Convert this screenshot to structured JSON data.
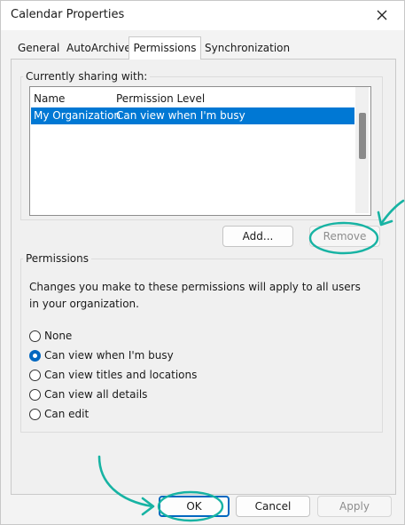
{
  "window": {
    "title": "Calendar Properties"
  },
  "tabs": [
    {
      "label": "General"
    },
    {
      "label": "AutoArchive"
    },
    {
      "label": "Permissions"
    },
    {
      "label": "Synchronization"
    }
  ],
  "sharing": {
    "legend": "Currently sharing with:",
    "columns": {
      "name": "Name",
      "permission": "Permission Level"
    },
    "rows": [
      {
        "name": "My Organization",
        "permission": "Can view when I'm busy"
      }
    ]
  },
  "buttons": {
    "add": "Add...",
    "remove": "Remove",
    "ok": "OK",
    "cancel": "Cancel",
    "apply": "Apply"
  },
  "permissions": {
    "legend": "Permissions",
    "description": "Changes you make to these permissions will apply to all users in your organization.",
    "options": [
      {
        "label": "None",
        "checked": false
      },
      {
        "label": "Can view when I'm busy",
        "checked": true
      },
      {
        "label": "Can view titles and locations",
        "checked": false
      },
      {
        "label": "Can view all details",
        "checked": false
      },
      {
        "label": "Can edit",
        "checked": false
      }
    ]
  },
  "colors": {
    "selection": "#0078d4",
    "annotation": "#17b3a3",
    "radio_checked": "#0067c0"
  }
}
